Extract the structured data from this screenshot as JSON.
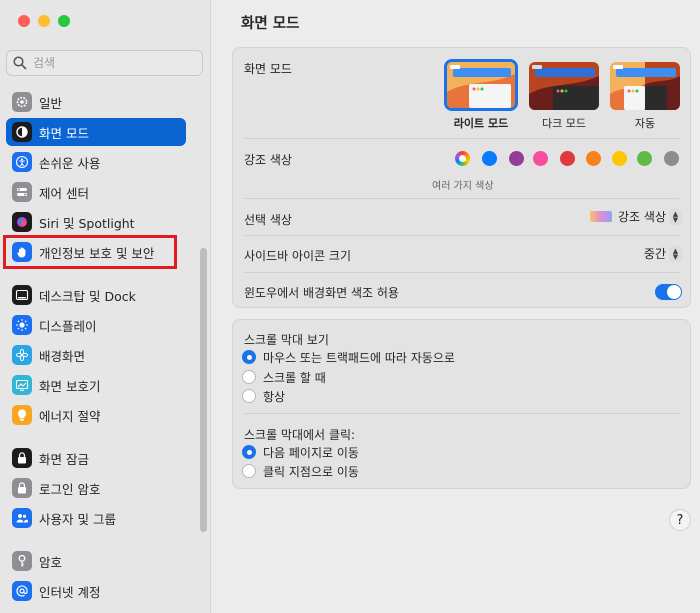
{
  "window": {
    "title": "화면 모드"
  },
  "colors": {
    "accent": "#0a64d2",
    "highlight": "#e11b22",
    "close": "#ff5f57",
    "minimize": "#febc2e",
    "zoom": "#28c840"
  },
  "search": {
    "placeholder": "검색",
    "value": ""
  },
  "sidebar": {
    "items": [
      {
        "label": "일반",
        "icon": "gear-icon",
        "color": "#8e8e93"
      },
      {
        "label": "화면 모드",
        "icon": "appearance-icon",
        "color": "#1c1c1e",
        "selected": true
      },
      {
        "label": "손쉬운 사용",
        "icon": "accessibility-icon",
        "color": "#1d6ff2"
      },
      {
        "label": "제어 센터",
        "icon": "control-center-icon",
        "color": "#8e8e93"
      },
      {
        "label": "Siri 및 Spotlight",
        "icon": "siri-icon",
        "color": "#1c1c1e"
      },
      {
        "label": "개인정보 보호 및 보안",
        "icon": "hand-icon",
        "color": "#1d6ff2"
      },
      {
        "label": "데스크탑 및 Dock",
        "icon": "dock-icon",
        "color": "#1c1c1e"
      },
      {
        "label": "디스플레이",
        "icon": "display-icon",
        "color": "#1d6ff2"
      },
      {
        "label": "배경화면",
        "icon": "wallpaper-icon",
        "color": "#2ba5e6"
      },
      {
        "label": "화면 보호기",
        "icon": "screensaver-icon",
        "color": "#33b6d6"
      },
      {
        "label": "에너지 절약",
        "icon": "bulb-icon",
        "color": "#f5a623"
      },
      {
        "label": "화면 잠금",
        "icon": "lock-icon",
        "color": "#1c1c1e"
      },
      {
        "label": "로그인 암호",
        "icon": "padlock-icon",
        "color": "#8e8e93"
      },
      {
        "label": "사용자 및 그룹",
        "icon": "users-icon",
        "color": "#1d6ff2"
      },
      {
        "label": "암호",
        "icon": "key-icon",
        "color": "#8e8e93"
      },
      {
        "label": "인터넷 계정",
        "icon": "at-icon",
        "color": "#1d6ff2"
      }
    ]
  },
  "appearance": {
    "label": "화면 모드",
    "options": [
      {
        "label": "라이트 모드",
        "selected": true
      },
      {
        "label": "다크 모드",
        "selected": false
      },
      {
        "label": "자동",
        "selected": false
      }
    ]
  },
  "accent": {
    "label": "강조 색상",
    "caption": "여러 가지 색상",
    "swatches": [
      "#8e44ad",
      "#0a7aff",
      "#953d96",
      "#f74f9e",
      "#e0383e",
      "#f7821b",
      "#ffc600",
      "#62ba46",
      "#8c8c8c"
    ]
  },
  "highlight_color": {
    "label": "선택 색상",
    "value": "강조 색상"
  },
  "sidebar_icon_size": {
    "label": "사이드바 아이콘 크기",
    "value": "중간"
  },
  "wallpaper_tint": {
    "label": "윈도우에서 배경화면 색조 허용",
    "on": true
  },
  "scrollbars": {
    "label": "스크롤 막대 보기",
    "options": [
      {
        "label": "마우스 또는 트랙패드에 따라 자동으로",
        "on": true
      },
      {
        "label": "스크롤 할 때",
        "on": false
      },
      {
        "label": "항상",
        "on": false
      }
    ]
  },
  "scroll_click": {
    "label": "스크롤 막대에서 클릭:",
    "options": [
      {
        "label": "다음 페이지로 이동",
        "on": true
      },
      {
        "label": "클릭 지점으로 이동",
        "on": false
      }
    ]
  },
  "help": {
    "label": "?"
  }
}
